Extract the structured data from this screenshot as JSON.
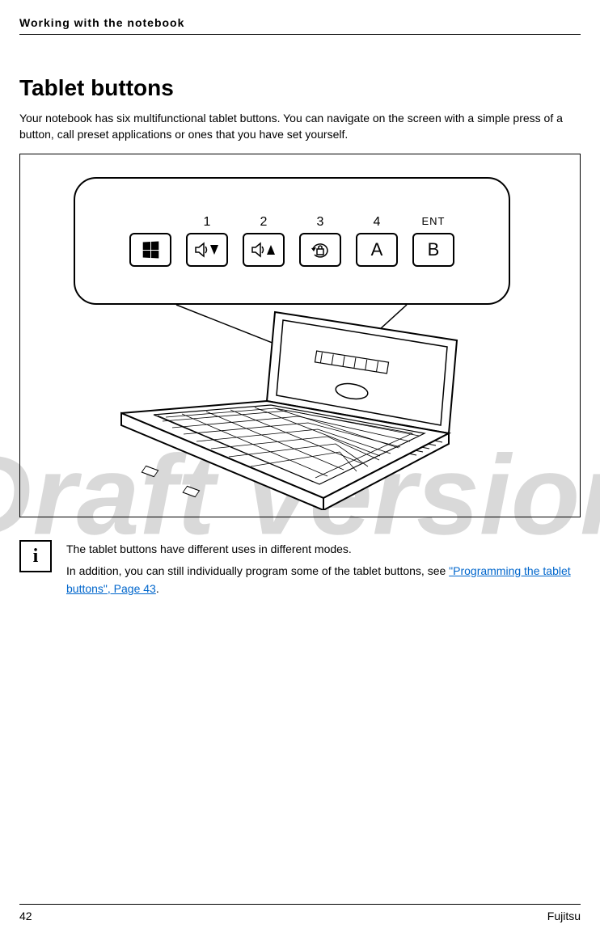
{
  "header": {
    "running_title": "Working with the notebook"
  },
  "section": {
    "heading": "Tablet buttons",
    "intro": "Your notebook has six multifunctional tablet buttons. You can navigate on the screen with a simple press of a button, call preset applications or ones that you have set yourself."
  },
  "panel": {
    "labels": [
      "",
      "1",
      "2",
      "3",
      "4",
      "ENT"
    ],
    "button_a": "A",
    "button_b": "B"
  },
  "watermark": "Draft version",
  "info": {
    "icon_char": "i",
    "line1": "The tablet buttons have different uses in different modes.",
    "line2_prefix": "In addition, you can still individually program some of the tablet buttons, see ",
    "link_text": "\"Programming the tablet buttons\", Page 43",
    "line2_suffix": "."
  },
  "footer": {
    "page_number": "42",
    "brand": "Fujitsu"
  }
}
